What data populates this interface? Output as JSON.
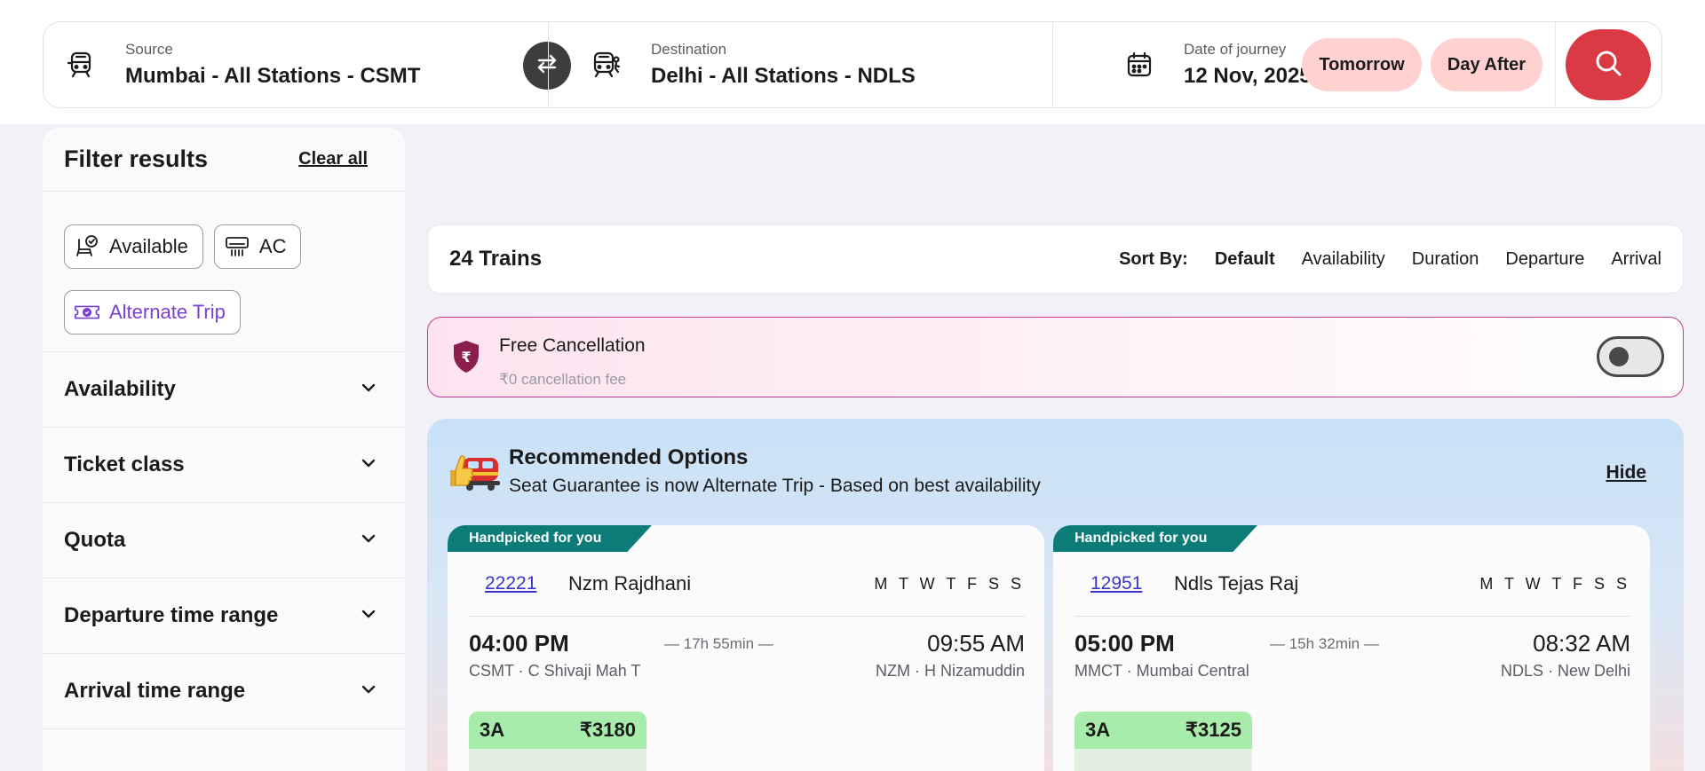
{
  "search": {
    "source_label": "Source",
    "source_value": "Mumbai - All Stations - CSMT",
    "destination_label": "Destination",
    "destination_value": "Delhi - All Stations - NDLS",
    "date_label": "Date of journey",
    "date_value": "12 Nov, 2025",
    "tomorrow": "Tomorrow",
    "day_after": "Day After"
  },
  "filters": {
    "title": "Filter results",
    "clear_all": "Clear all",
    "chips": [
      "Available",
      "AC",
      "Alternate Trip"
    ],
    "sections": [
      "Availability",
      "Ticket class",
      "Quota",
      "Departure time range",
      "Arrival time range"
    ]
  },
  "results": {
    "count": "24 Trains",
    "sort_label": "Sort By:",
    "sort_options": [
      "Default",
      "Availability",
      "Duration",
      "Departure",
      "Arrival"
    ],
    "active_sort": "Default"
  },
  "free_cancellation": {
    "title": "Free Cancellation",
    "subtitle": "₹0 cancellation fee",
    "enabled": false
  },
  "recommended": {
    "title": "Recommended Options",
    "subtitle": "Seat Guarantee is now Alternate Trip - Based on best availability",
    "hide": "Hide",
    "cards": [
      {
        "tag": "Handpicked for you",
        "number": "22221",
        "name": "Nzm Rajdhani",
        "days": "M T W T F S S",
        "dep_time": "04:00 PM",
        "duration": "— 17h 55min —",
        "arr_time": "09:55 AM",
        "dep_station": "CSMT · C Shivaji Mah T",
        "arr_station": "NZM · H Nizamuddin",
        "class": "3A",
        "price": "₹3180"
      },
      {
        "tag": "Handpicked for you",
        "number": "12951",
        "name": "Ndls Tejas Raj",
        "days": "M T W T F S S",
        "dep_time": "05:00 PM",
        "duration": "— 15h 32min —",
        "arr_time": "08:32 AM",
        "dep_station": "MMCT · Mumbai Central",
        "arr_station": "NDLS · New Delhi",
        "class": "3A",
        "price": "₹3125"
      }
    ]
  },
  "colors": {
    "accent_red": "#d93a44",
    "pill_pink": "#ffd1d1",
    "teal_tag": "#0d7c78",
    "link_blue": "#3b35c9",
    "class_green": "#a8ecab",
    "cancellation_border": "#c43a8e"
  },
  "icons": {
    "source": "train-front-icon",
    "destination": "train-arrival-icon",
    "swap": "swap-arrows-icon",
    "date": "calendar-icon",
    "search": "search-icon",
    "chip_available": "seat-check-icon",
    "chip_ac": "air-conditioner-icon",
    "chip_alternate": "ticket-icon",
    "accordion": "chevron-down-icon",
    "cancellation": "rupee-shield-icon",
    "recommended": "thumbs-up-train-icon"
  }
}
